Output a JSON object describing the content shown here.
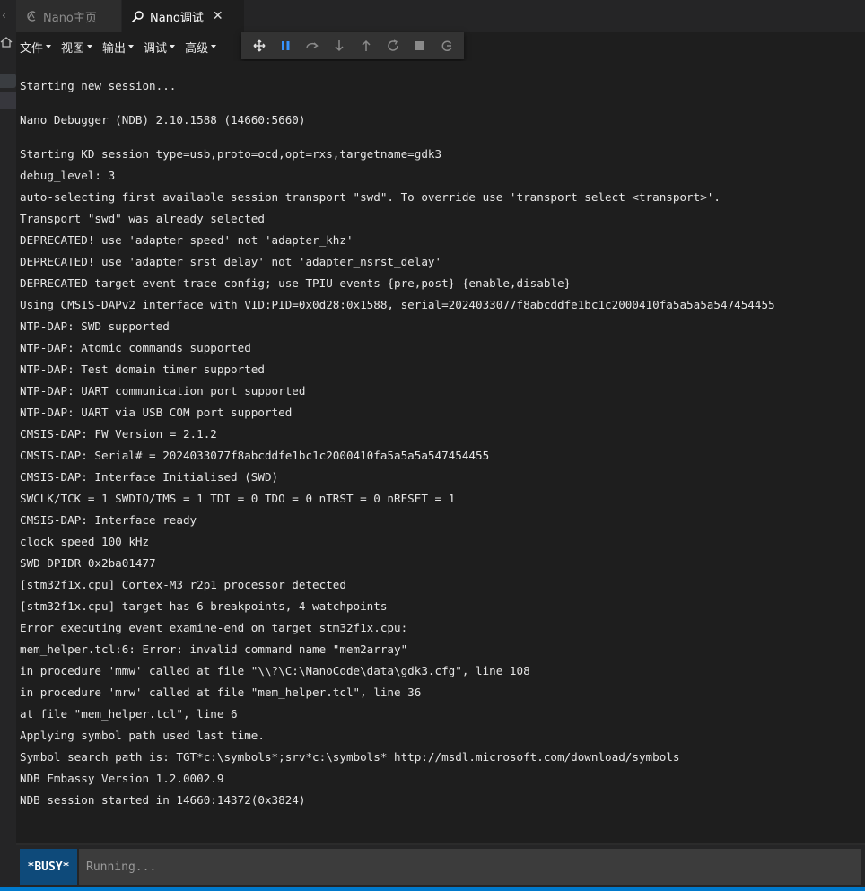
{
  "tabs": [
    {
      "label": "Nano主页",
      "icon": "nano-logo-icon",
      "active": false
    },
    {
      "label": "Nano调试",
      "icon": "debug-search-icon",
      "active": true,
      "close": "✕"
    }
  ],
  "menu": [
    {
      "label": "文件"
    },
    {
      "label": "视图"
    },
    {
      "label": "输出"
    },
    {
      "label": "调试"
    },
    {
      "label": "高级"
    }
  ],
  "debug_toolbar": [
    "grip-icon",
    "pause-icon",
    "step-over-icon",
    "step-into-icon",
    "step-out-icon",
    "restart-icon",
    "stop-icon",
    "disconnect-icon"
  ],
  "colors": {
    "accent": "#007acc",
    "busy_badge": "#0e4a7a",
    "pause": "#3794ff"
  },
  "output_lines": [
    "Starting new session...",
    "Nano Debugger (NDB) 2.10.1588 (14660:5660)",
    "Starting KD session type=usb,proto=ocd,opt=rxs,targetname=gdk3",
    "debug_level: 3",
    "auto-selecting first available session transport \"swd\". To override use 'transport select <transport>'.",
    "Transport \"swd\" was already selected",
    "DEPRECATED! use 'adapter speed' not 'adapter_khz'",
    "DEPRECATED! use 'adapter srst delay' not 'adapter_nsrst_delay'",
    "DEPRECATED target event trace-config; use TPIU events {pre,post}-{enable,disable}",
    "Using CMSIS-DAPv2 interface with VID:PID=0x0d28:0x1588, serial=2024033077f8abcddfe1bc1c2000410fa5a5a5a547454455",
    "NTP-DAP: SWD supported",
    "NTP-DAP: Atomic commands supported",
    "NTP-DAP: Test domain timer supported",
    "NTP-DAP: UART communication port supported",
    "NTP-DAP: UART via USB COM port supported",
    "CMSIS-DAP: FW Version = 2.1.2",
    "CMSIS-DAP: Serial# = 2024033077f8abcddfe1bc1c2000410fa5a5a5a547454455",
    "CMSIS-DAP: Interface Initialised (SWD)",
    "SWCLK/TCK = 1 SWDIO/TMS = 1 TDI = 0 TDO = 0 nTRST = 0 nRESET = 1",
    "CMSIS-DAP: Interface ready",
    "clock speed 100 kHz",
    "SWD DPIDR 0x2ba01477",
    "[stm32f1x.cpu] Cortex-M3 r2p1 processor detected",
    "[stm32f1x.cpu] target has 6 breakpoints, 4 watchpoints",
    "Error executing event examine-end on target stm32f1x.cpu:",
    "mem_helper.tcl:6: Error: invalid command name \"mem2array\"",
    "in procedure 'mmw' called at file \"\\\\?\\C:\\NanoCode\\data\\gdk3.cfg\", line 108",
    "in procedure 'mrw' called at file \"mem_helper.tcl\", line 36",
    "at file \"mem_helper.tcl\", line 6",
    "Applying symbol path used last time.",
    "Symbol search path is: TGT*c:\\symbols*;srv*c:\\symbols* http://msdl.microsoft.com/download/symbols",
    "NDB Embassy Version 1.2.0002.9",
    "NDB session started in 14660:14372(0x3824)"
  ],
  "command": {
    "status_badge": "*BUSY*",
    "placeholder": "Running..."
  }
}
